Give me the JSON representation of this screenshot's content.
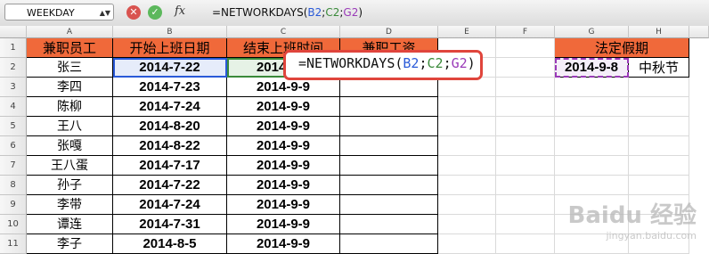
{
  "formula_bar": {
    "name_box": "WEEKDAY",
    "formula_prefix": "=NETWORKDAYS(",
    "arg1": "B2",
    "sep1": ";",
    "arg2": "C2",
    "sep2": ";",
    "arg3": "G2",
    "suffix": ")",
    "fx_label": "fx"
  },
  "columns": [
    "A",
    "B",
    "C",
    "D",
    "E",
    "F",
    "G",
    "H"
  ],
  "rows": [
    "1",
    "2",
    "3",
    "4",
    "5",
    "6",
    "7",
    "8",
    "9",
    "10",
    "11"
  ],
  "headers": {
    "a": "兼职员工",
    "b": "开始上班日期",
    "c": "结束上班时间",
    "d": "兼职工资",
    "g": "法定假期"
  },
  "table": [
    {
      "name": "张三",
      "start": "2014-7-22",
      "end": "2014-9-9"
    },
    {
      "name": "李四",
      "start": "2014-7-23",
      "end": "2014-9-9"
    },
    {
      "name": "陈柳",
      "start": "2014-7-24",
      "end": "2014-9-9"
    },
    {
      "name": "王八",
      "start": "2014-8-20",
      "end": "2014-9-9"
    },
    {
      "name": "张嘎",
      "start": "2014-8-22",
      "end": "2014-9-9"
    },
    {
      "name": "王八蛋",
      "start": "2014-7-17",
      "end": "2014-9-9"
    },
    {
      "name": "孙子",
      "start": "2014-7-22",
      "end": "2014-9-9"
    },
    {
      "name": "李带",
      "start": "2014-7-24",
      "end": "2014-9-9"
    },
    {
      "name": "谭连",
      "start": "2014-7-31",
      "end": "2014-9-9"
    },
    {
      "name": "李子",
      "start": "2014-8-5",
      "end": "2014-9-9"
    }
  ],
  "holiday": {
    "date": "2014-9-8",
    "name": "中秋节"
  },
  "tooltip": {
    "text_prefix": "=NETWORKDAYS(",
    "a1": "B2",
    "s1": ";",
    "a2": "C2",
    "s2": ";",
    "a3": "G2",
    "suffix": ")"
  },
  "watermark": {
    "main": "Baidu 经验",
    "sub": "jingyan.baidu.com"
  },
  "colors": {
    "header_bg": "#f0693a",
    "ref_b": "#2a5ad8",
    "ref_c": "#3a8a3a",
    "ref_g": "#9a3ab8",
    "tip_border": "#e0453c"
  }
}
